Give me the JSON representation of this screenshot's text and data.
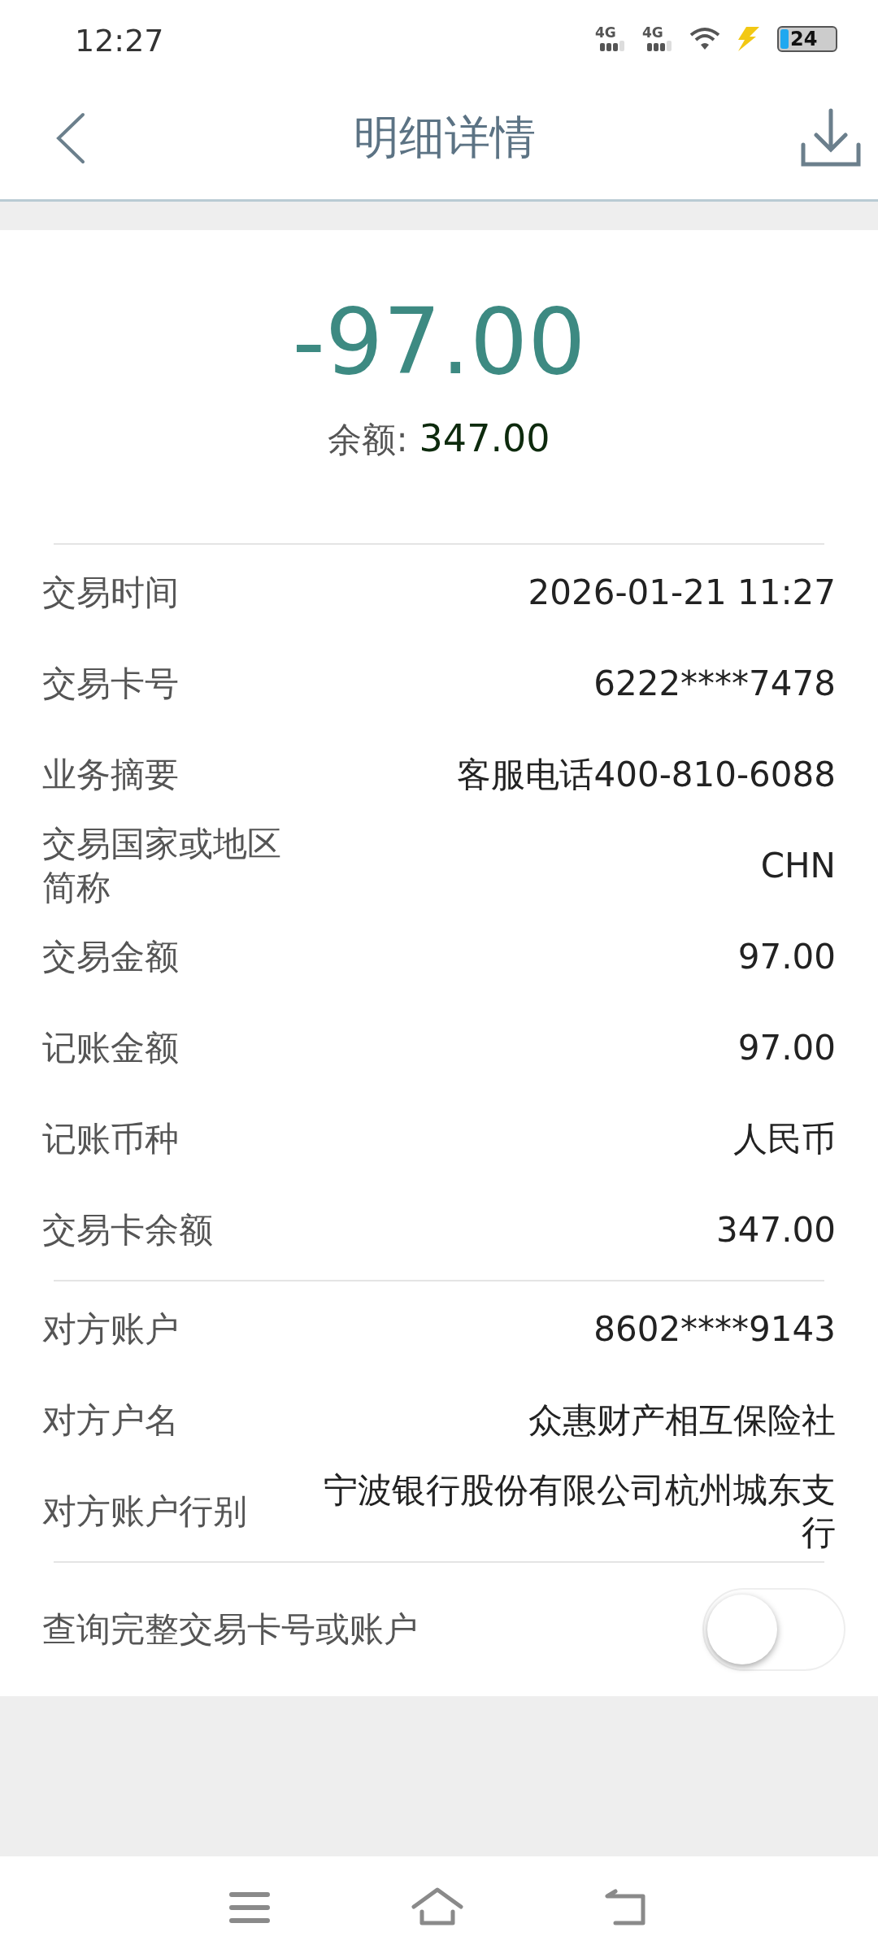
{
  "status_bar": {
    "time": "12:27",
    "networks": [
      "4G",
      "4G"
    ],
    "battery": "24"
  },
  "header": {
    "title": "明细详情"
  },
  "summary": {
    "amount": "-97.00",
    "balance_label": "余额:",
    "balance": "347.00"
  },
  "sections": [
    {
      "rows": [
        {
          "label": "交易时间",
          "value": "2026-01-21 11:27"
        },
        {
          "label": "交易卡号",
          "value": "6222****7478"
        },
        {
          "label": "业务摘要",
          "value": "客服电话400-810-6088"
        },
        {
          "label": "交易国家或地区简称",
          "value": "CHN"
        },
        {
          "label": "交易金额",
          "value": "97.00"
        },
        {
          "label": "记账金额",
          "value": "97.00"
        },
        {
          "label": "记账币种",
          "value": "人民币"
        },
        {
          "label": "交易卡余额",
          "value": "347.00"
        }
      ]
    },
    {
      "rows": [
        {
          "label": "对方账户",
          "value": "8602****9143"
        },
        {
          "label": "对方户名",
          "value": "众惠财产相互保险社"
        },
        {
          "label": "对方账户行别",
          "value": "宁波银行股份有限公司杭州城东支行"
        }
      ]
    }
  ],
  "toggle": {
    "label": "查询完整交易卡号或账户",
    "on": false
  }
}
